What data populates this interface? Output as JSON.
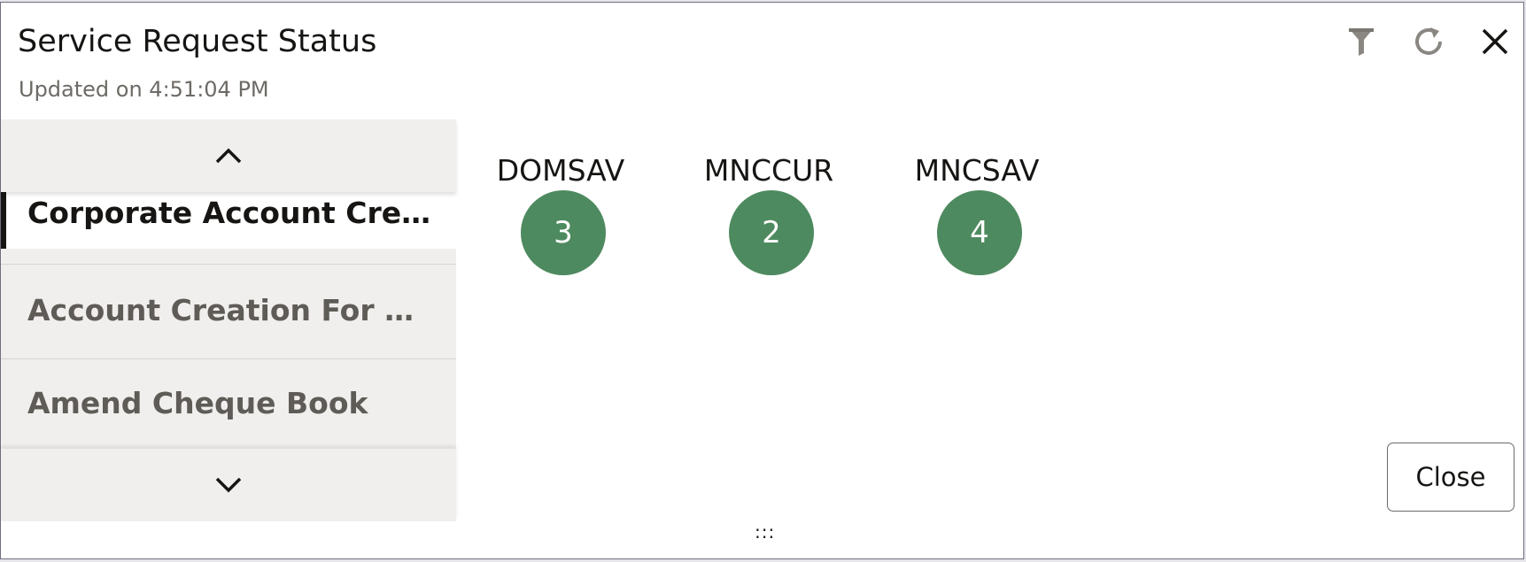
{
  "dialog": {
    "title": "Service Request Status",
    "subtitle": "Updated on 4:51:04 PM"
  },
  "header_actions": [
    {
      "name": "filter-icon"
    },
    {
      "name": "refresh-icon"
    },
    {
      "name": "close-icon"
    }
  ],
  "sidebar": {
    "items": [
      {
        "label": "Corporate Account Creation",
        "active": true
      },
      {
        "label": "Account Creation For New…",
        "active": false
      },
      {
        "label": "Amend Cheque Book",
        "active": false
      }
    ]
  },
  "tiles": [
    {
      "label": "DOMSAV",
      "count": "3"
    },
    {
      "label": "MNCCUR",
      "count": "2"
    },
    {
      "label": "MNCSAV",
      "count": "4"
    }
  ],
  "footer": {
    "close_label": "Close",
    "grip": ":::"
  },
  "colors": {
    "circle": "#4e8a5f",
    "active_border": "#161513",
    "sidebar_bg": "#f0efed"
  }
}
